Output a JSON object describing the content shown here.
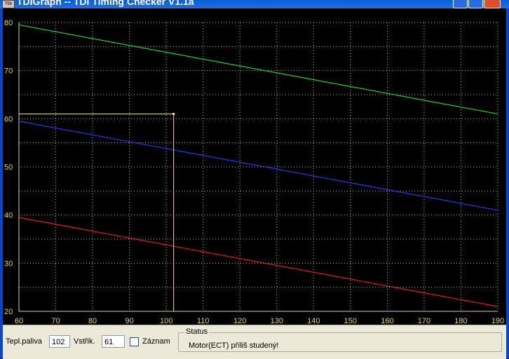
{
  "window": {
    "title": "TDIGraph -- TDI Timing Checker V1.1a",
    "app_icon_text": "TDI"
  },
  "chart_data": {
    "type": "line",
    "xlim": [
      60,
      190
    ],
    "ylim": [
      20,
      80
    ],
    "x_ticks": [
      "60",
      "70",
      "80",
      "90",
      "100",
      "110",
      "120",
      "130",
      "140",
      "150",
      "160",
      "170",
      "180",
      "190"
    ],
    "y_ticks": [
      "80",
      "70",
      "60",
      "50",
      "40",
      "30",
      "20"
    ],
    "grid": true,
    "series": [
      {
        "color": "#2ecc2e",
        "x": [
          60,
          190
        ],
        "y": [
          79.5,
          61
        ]
      },
      {
        "color": "#2a3ce0",
        "x": [
          60,
          190
        ],
        "y": [
          59.5,
          41
        ]
      },
      {
        "color": "#e02020",
        "x": [
          60,
          190
        ],
        "y": [
          39.5,
          21
        ]
      }
    ],
    "cursor": {
      "color": "#f0e68c",
      "x": 102,
      "y": 61
    }
  },
  "controls": {
    "fuel_temp_label": "Tepl.paliva",
    "fuel_temp_value": "102",
    "injection_label": "Vstřik.",
    "injection_value": "61",
    "record_label": "Záznam",
    "record_checked": false,
    "status_title": "Status",
    "status_message": "Motor(ECT) příliš studený!"
  }
}
